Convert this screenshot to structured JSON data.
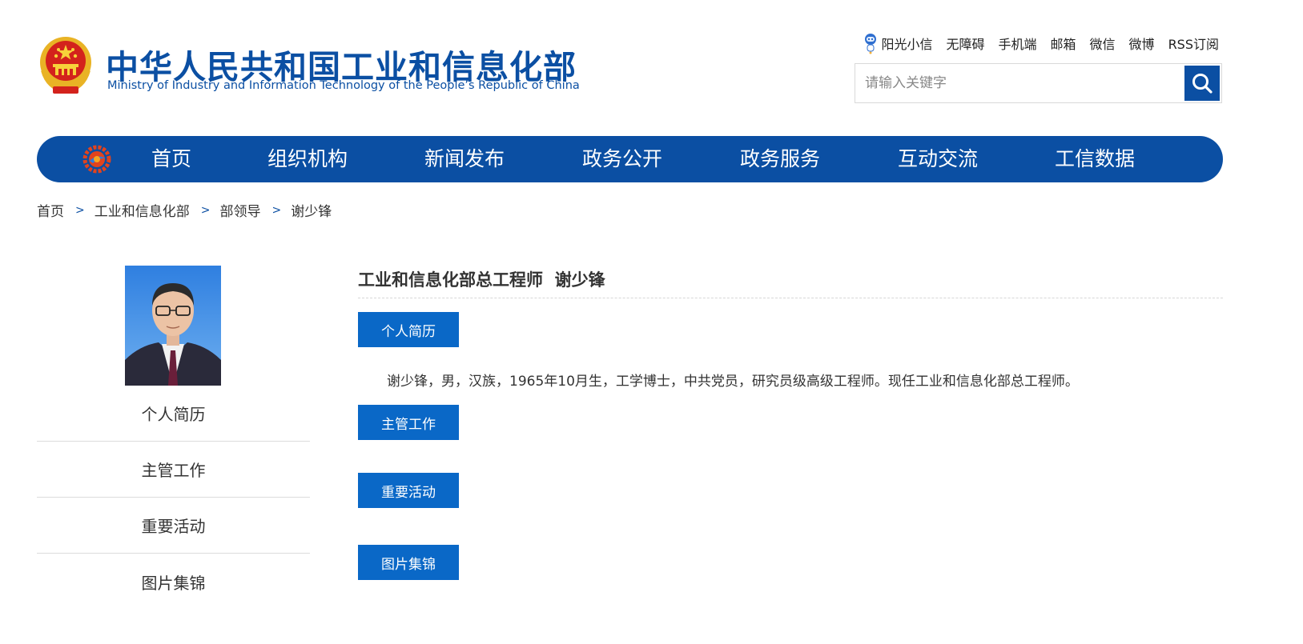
{
  "header": {
    "title": "中华人民共和国工业和信息化部",
    "subtitle": "Ministry of Industry and Information Technology of the People’s Republic of China",
    "top_links": [
      "阳光小信",
      "无障碍",
      "手机端",
      "邮箱",
      "微信",
      "微博",
      "RSS订阅"
    ],
    "search_placeholder": "请输入关键字",
    "colors": {
      "brand_blue": "#0b4fa3",
      "button_blue": "#0a68c7"
    },
    "icons": [
      "national-emblem-icon",
      "robot-mascot-icon",
      "search-icon",
      "miit-logo-icon"
    ]
  },
  "nav": {
    "items": [
      "首页",
      "组织机构",
      "新闻发布",
      "政务公开",
      "政务服务",
      "互动交流",
      "工信数据"
    ]
  },
  "breadcrumb": [
    "首页",
    "工业和信息化部",
    "部领导",
    "谢少锋"
  ],
  "sidebar": {
    "items": [
      "个人简历",
      "主管工作",
      "重要活动",
      "图片集锦"
    ]
  },
  "main": {
    "title": "工业和信息化部总工程师  谢少锋",
    "sections": [
      "个人简历",
      "主管工作",
      "重要活动",
      "图片集锦"
    ],
    "bio": "谢少锋，男，汉族，1965年10月生，工学博士，中共党员，研究员级高级工程师。现任工业和信息化部总工程师。"
  }
}
